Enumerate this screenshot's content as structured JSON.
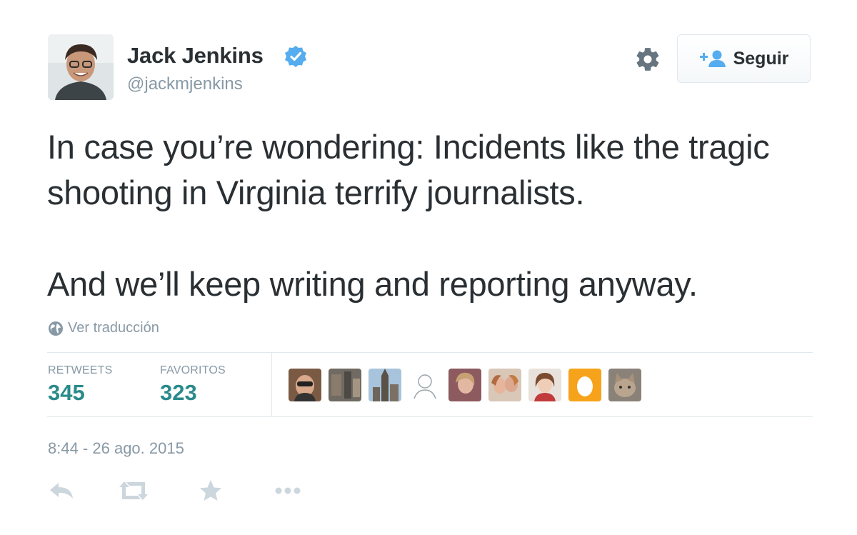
{
  "author": {
    "display_name": "Jack Jenkins",
    "handle": "@jackmjenkins",
    "verified": true
  },
  "header": {
    "follow_label": "Seguir"
  },
  "tweet": {
    "paragraph_1": "In case you’re wondering: Incidents like the tragic shooting in Virginia terrify journalists.",
    "paragraph_2": "And we’ll keep writing and reporting anyway.",
    "translate_label": "Ver traducción",
    "timestamp": "8:44 - 26 ago. 2015"
  },
  "stats": {
    "retweets_label": "RETWEETS",
    "retweets_value": "345",
    "favorites_label": "FAVORITOS",
    "favorites_value": "323"
  },
  "colors": {
    "accent": "#55acee",
    "stat_value": "#2b8a8a",
    "muted": "#8899a6",
    "text": "#292f33"
  },
  "icons": [
    "gear-icon",
    "verified-badge-icon",
    "follow-user-icon",
    "globe-icon",
    "reply-icon",
    "retweet-icon",
    "star-icon",
    "more-icon"
  ]
}
